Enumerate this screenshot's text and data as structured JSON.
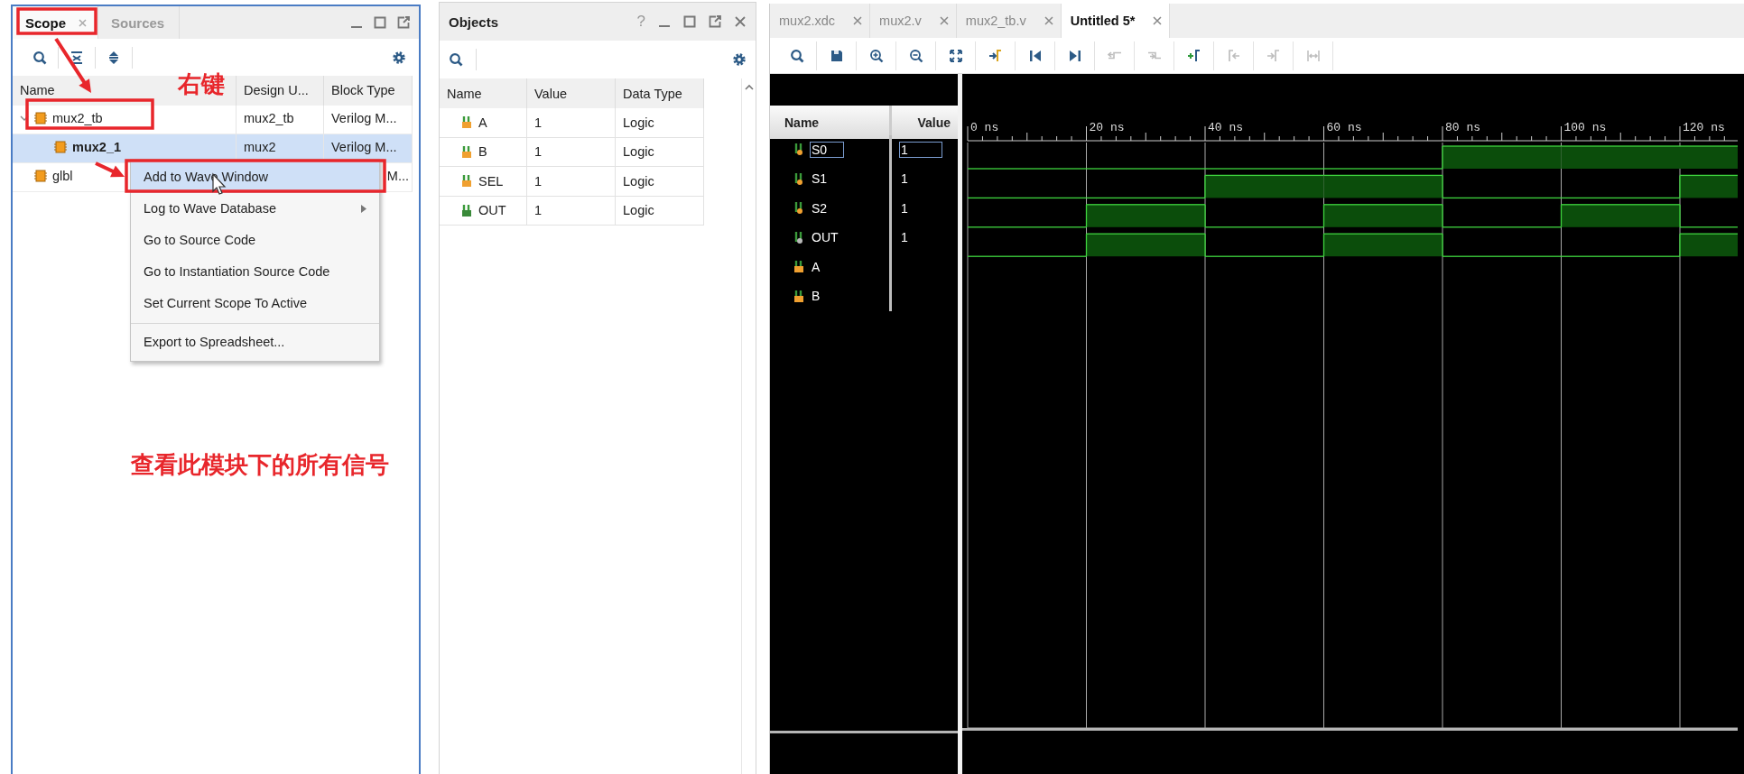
{
  "scope_panel": {
    "tabs": [
      {
        "label": "Scope",
        "selected": true
      },
      {
        "label": "Sources",
        "selected": false
      }
    ],
    "columns": [
      "Name",
      "Design U...",
      "Block Type"
    ],
    "rows": [
      {
        "name": "mux2_tb",
        "design_unit": "mux2_tb",
        "block_type": "Verilog M...",
        "selected": false,
        "expanded": true,
        "children": [
          {
            "name": "mux2_1",
            "design_unit": "mux2",
            "block_type": "Verilog M...",
            "selected": true
          }
        ]
      },
      {
        "name": "glbl",
        "block_type": "M...",
        "selected": false
      }
    ],
    "context_menu": [
      {
        "label": "Add to Wave Window",
        "highlighted": true,
        "submenu": false,
        "separator_before": false
      },
      {
        "label": "Log to Wave Database",
        "highlighted": false,
        "submenu": true,
        "separator_before": false
      },
      {
        "label": "Go to Source Code",
        "highlighted": false,
        "submenu": false,
        "separator_before": false
      },
      {
        "label": "Go to Instantiation Source Code",
        "highlighted": false,
        "submenu": false,
        "separator_before": false
      },
      {
        "label": "Set Current Scope To Active",
        "highlighted": false,
        "submenu": false,
        "separator_before": false
      },
      {
        "label": "Export to Spreadsheet...",
        "highlighted": false,
        "submenu": false,
        "separator_before": true
      }
    ]
  },
  "objects_panel": {
    "title": "Objects",
    "help": "?",
    "columns": [
      "Name",
      "Value",
      "Data Type"
    ],
    "rows": [
      {
        "name": "A",
        "value": "1",
        "data_type": "Logic",
        "kind": "input"
      },
      {
        "name": "B",
        "value": "1",
        "data_type": "Logic",
        "kind": "input"
      },
      {
        "name": "SEL",
        "value": "1",
        "data_type": "Logic",
        "kind": "input"
      },
      {
        "name": "OUT",
        "value": "1",
        "data_type": "Logic",
        "kind": "output"
      }
    ]
  },
  "wave_panel": {
    "tabs": [
      {
        "label": "mux2.xdc",
        "selected": false
      },
      {
        "label": "mux2.v",
        "selected": false
      },
      {
        "label": "mux2_tb.v",
        "selected": false
      },
      {
        "label": "Untitled 5*",
        "selected": true
      }
    ],
    "toolbar": [
      {
        "kind": "search",
        "disabled": false
      },
      {
        "kind": "save",
        "disabled": false
      },
      {
        "kind": "zoom_in",
        "disabled": false
      },
      {
        "kind": "zoom_out",
        "disabled": false
      },
      {
        "kind": "zoom_fit",
        "disabled": false
      },
      {
        "kind": "goto_cursor",
        "disabled": false
      },
      {
        "kind": "go_start",
        "disabled": false
      },
      {
        "kind": "go_end",
        "disabled": false
      },
      {
        "kind": "prev_transition",
        "disabled": true
      },
      {
        "kind": "next_transition",
        "disabled": true
      },
      {
        "kind": "add_marker",
        "disabled": false
      },
      {
        "kind": "prev_marker",
        "disabled": true
      },
      {
        "kind": "next_marker",
        "disabled": true
      },
      {
        "kind": "swap_cursors",
        "disabled": true
      }
    ],
    "columns": [
      "Name",
      "Value"
    ],
    "time_labels": [
      "0 ns",
      "20 ns",
      "40 ns",
      "60 ns",
      "80 ns",
      "100 ns",
      "120 ns"
    ],
    "signals": [
      {
        "name": "S0",
        "value": "1",
        "kind": "reg",
        "selected": true,
        "high": [
          false,
          false,
          false,
          false,
          true,
          true,
          true
        ]
      },
      {
        "name": "S1",
        "value": "1",
        "kind": "reg",
        "selected": false,
        "high": [
          false,
          false,
          true,
          true,
          false,
          false,
          true
        ]
      },
      {
        "name": "S2",
        "value": "1",
        "kind": "reg",
        "selected": false,
        "high": [
          false,
          true,
          false,
          true,
          false,
          true,
          false
        ]
      },
      {
        "name": "OUT",
        "value": "1",
        "kind": "wire",
        "selected": false,
        "high": [
          false,
          true,
          false,
          true,
          false,
          false,
          true
        ]
      },
      {
        "name": "A",
        "kind": "input",
        "selected": false
      },
      {
        "name": "B",
        "kind": "input",
        "selected": false
      }
    ]
  },
  "annotations": {
    "labels": [
      "右键",
      "查看此模块下的所有信号"
    ]
  }
}
